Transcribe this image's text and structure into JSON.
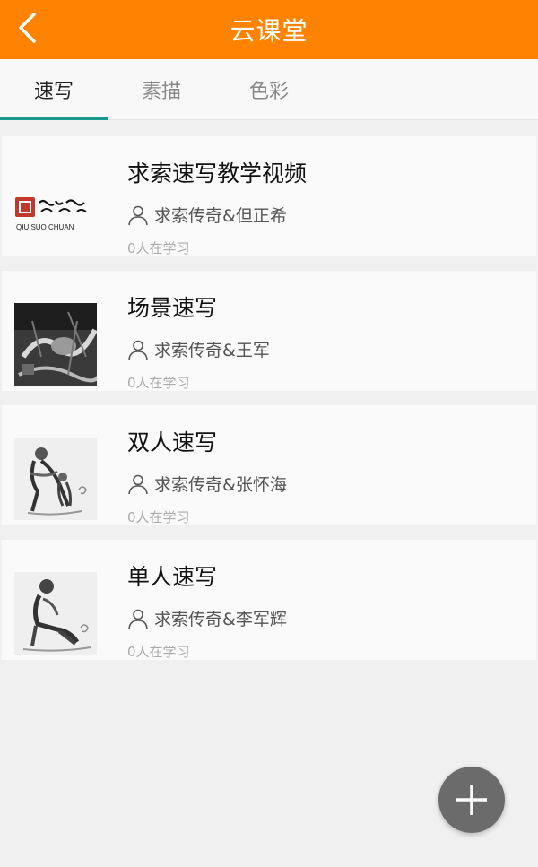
{
  "header": {
    "title": "云课堂",
    "back_icon": "chevron-left-icon",
    "bg_color": "#ff8200"
  },
  "tabs": [
    {
      "label": "速写",
      "active": true
    },
    {
      "label": "素描",
      "active": false
    },
    {
      "label": "色彩",
      "active": false
    }
  ],
  "courses": [
    {
      "title": "求索速写教学视频",
      "author": "求索传奇&但正希",
      "learners": "0人在学习",
      "logo_text": "QIU SUO CHUAN"
    },
    {
      "title": "场景速写",
      "author": "求索传奇&王军",
      "learners": "0人在学习"
    },
    {
      "title": "双人速写",
      "author": "求索传奇&张怀海",
      "learners": "0人在学习"
    },
    {
      "title": "单人速写",
      "author": "求索传奇&李军辉",
      "learners": "0人在学习"
    }
  ],
  "fab": {
    "icon": "plus-icon"
  },
  "accent_color": "#1a9a8a"
}
